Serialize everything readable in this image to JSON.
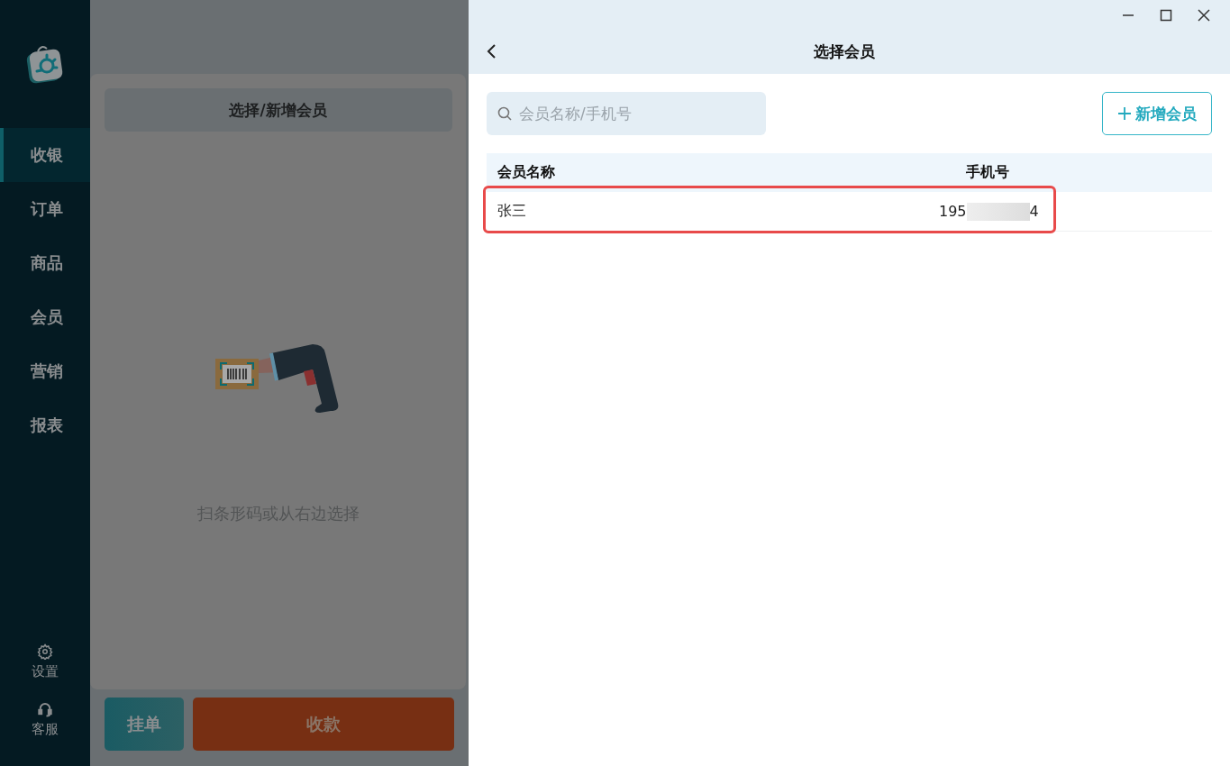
{
  "sidebar": {
    "items": [
      {
        "label": "收银",
        "selected": true
      },
      {
        "label": "订单",
        "selected": false
      },
      {
        "label": "商品",
        "selected": false
      },
      {
        "label": "会员",
        "selected": false
      },
      {
        "label": "营销",
        "selected": false
      },
      {
        "label": "报表",
        "selected": false
      }
    ],
    "bottom_items": [
      {
        "label": "设置",
        "kind": "settings"
      },
      {
        "label": "客服",
        "kind": "support"
      }
    ]
  },
  "cart": {
    "member_button": "选择/新增会员",
    "empty_hint": "扫条形码或从右边选择",
    "hold_button": "挂单",
    "pay_button": "收款"
  },
  "drawer": {
    "title": "选择会员",
    "search": {
      "placeholder": "会员名称/手机号"
    },
    "add_button": "新增会员",
    "table": {
      "columns": [
        "会员名称",
        "手机号"
      ],
      "rows": [
        {
          "name": "张三",
          "phone_start": "195",
          "phone_end": "4",
          "highlighted": true
        }
      ]
    }
  }
}
